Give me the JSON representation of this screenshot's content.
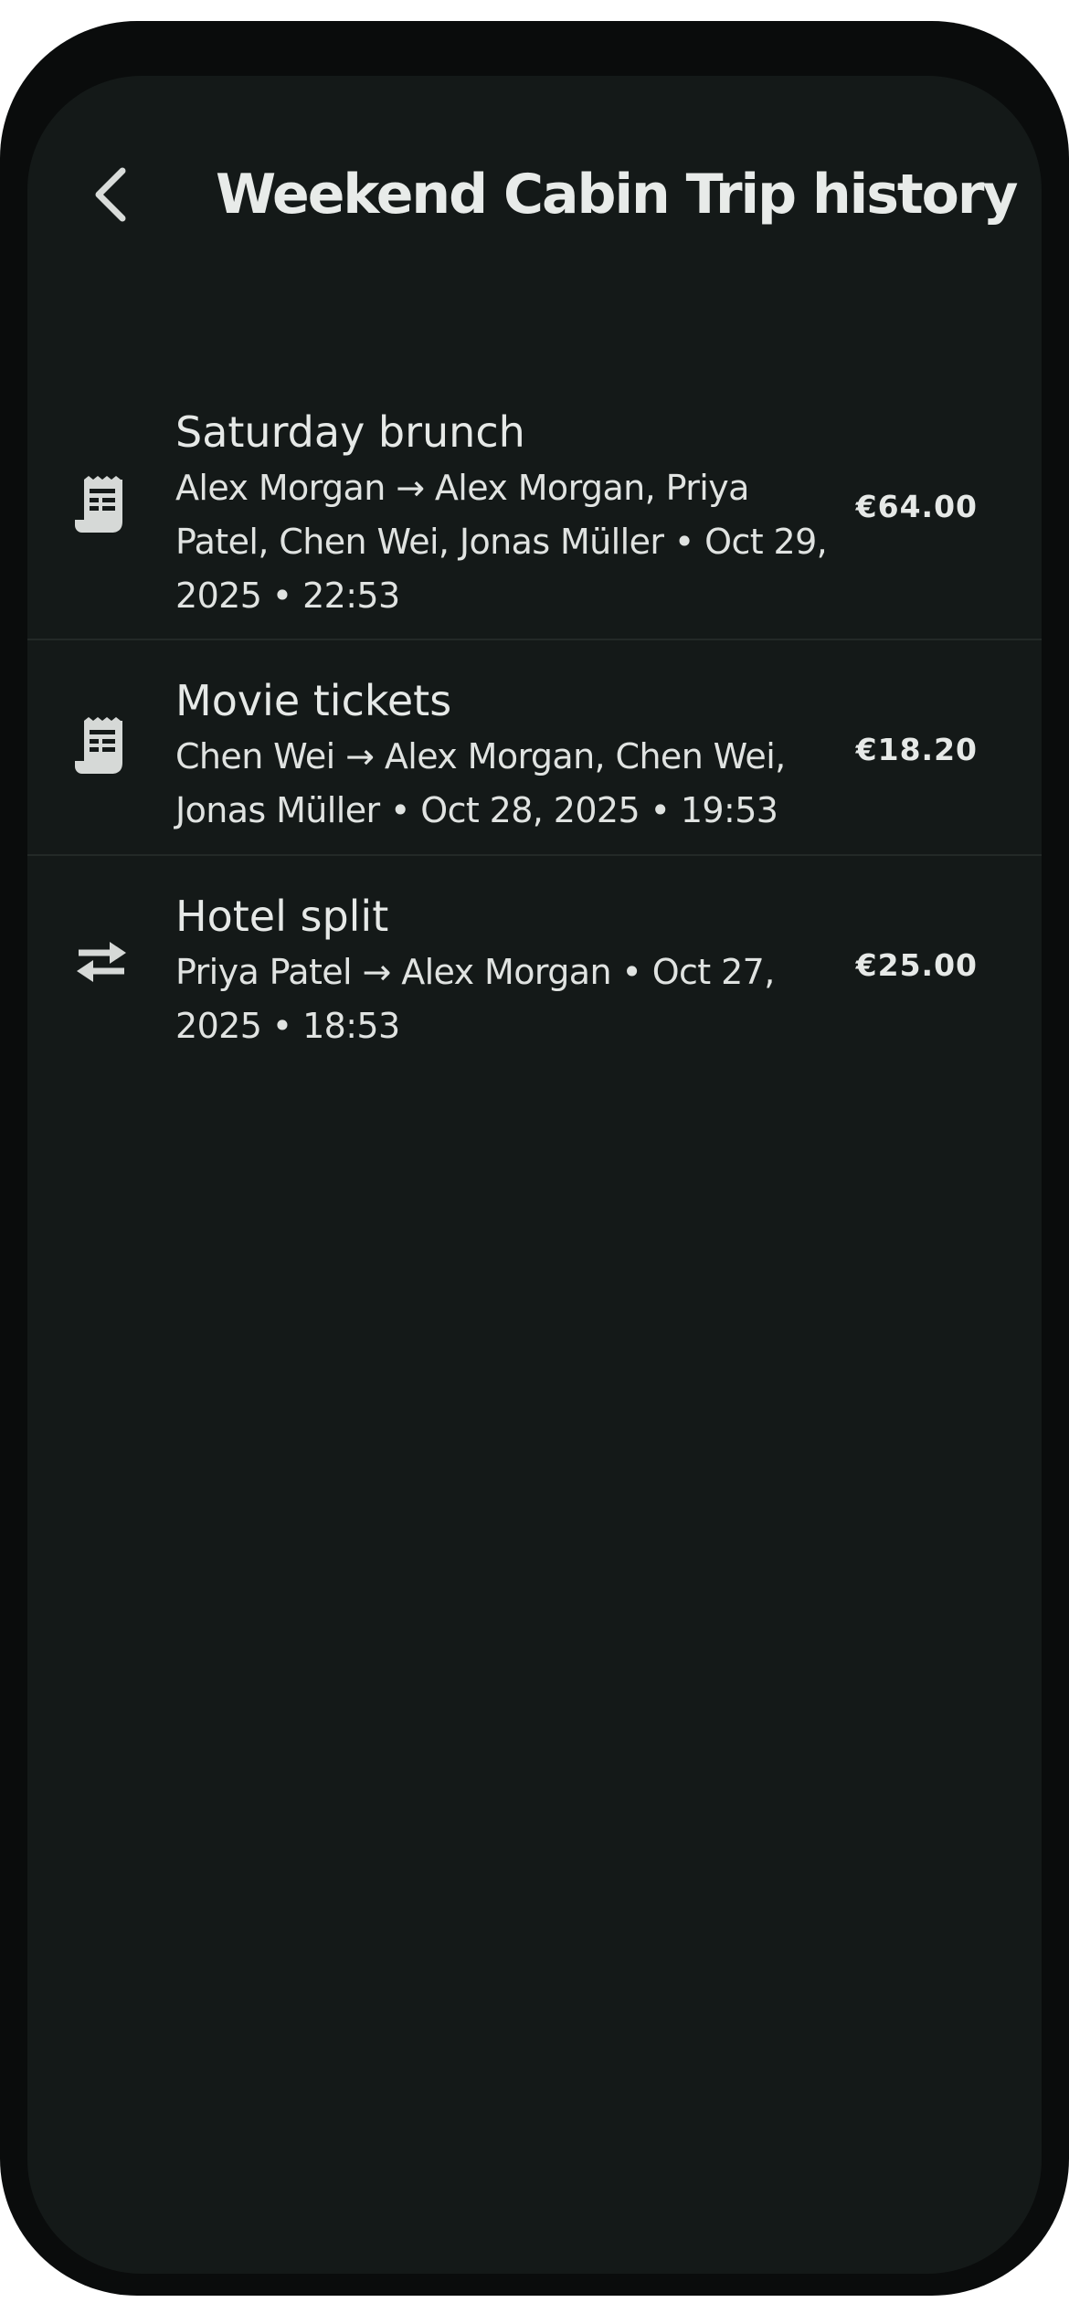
{
  "header": {
    "title": "Weekend Cabin Trip history",
    "back_icon": "chevron-left-icon"
  },
  "transactions": [
    {
      "title": "Saturday brunch",
      "meta": "Alex Morgan → Alex Morgan, Priya Patel, Chen Wei, Jonas Müller • Oct 29, 2025 • 22:53",
      "amount": "€64.00",
      "icon": "receipt-icon"
    },
    {
      "title": "Movie tickets",
      "meta": "Chen Wei → Alex Morgan, Chen Wei, Jonas Müller • Oct 28, 2025 • 19:53",
      "amount": "€18.20",
      "icon": "receipt-icon"
    },
    {
      "title": "Hotel split",
      "meta": "Priya Patel → Alex Morgan • Oct 27, 2025 • 18:53",
      "amount": "€25.00",
      "icon": "transfer-icon"
    }
  ],
  "colors": {
    "background": "#141918",
    "frame": "#0a0c0c",
    "text": "#e6e9e7",
    "divider": "#232927"
  }
}
